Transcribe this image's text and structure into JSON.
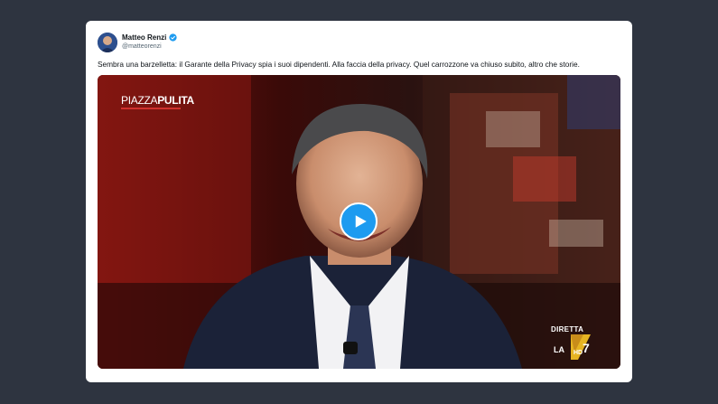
{
  "tweet": {
    "display_name": "Matteo Renzi",
    "handle": "@matteorenzi",
    "verified": true,
    "text": "Sembra una barzelletta: il Garante della Privacy spia i suoi dipendenti. Alla faccia della privacy. Quel carrozzone va chiuso subito, altro che storie.",
    "avatar_icon": "avatar-photo"
  },
  "video": {
    "show_logo_part1": "PIAZZA",
    "show_logo_part2": "PULITA",
    "live_label": "DIRETTA",
    "channel_label": "LA",
    "channel_number": "7",
    "hd_label": "HD",
    "play_icon": "play-icon"
  },
  "colors": {
    "background": "#2e3440",
    "card": "#ffffff",
    "accent_blue": "#1d9bf0",
    "logo_red": "#d0312d"
  }
}
